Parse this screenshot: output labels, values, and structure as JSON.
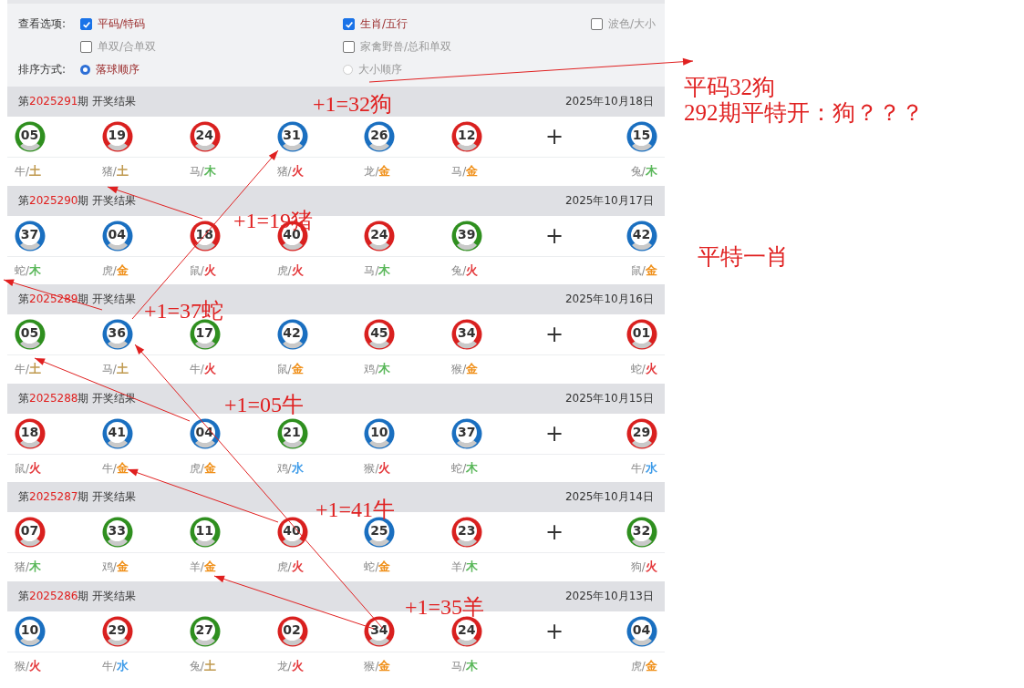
{
  "options": {
    "view_label": "查看选项:",
    "view_options": [
      {
        "label": "平码/特码",
        "checked": true
      },
      {
        "label": "生肖/五行",
        "checked": true
      },
      {
        "label": "波色/大小",
        "checked": false
      },
      {
        "label": "单双/合单双",
        "checked": false
      },
      {
        "label": "家禽野兽/总和单双",
        "checked": false
      }
    ],
    "sort_label": "排序方式:",
    "sort_options": [
      {
        "label": "落球顺序",
        "selected": true
      },
      {
        "label": "大小顺序",
        "selected": false
      }
    ]
  },
  "draws": [
    {
      "title_prefix": "第",
      "period": "2025291",
      "title_suffix": "期 开奖结果",
      "date": "2025年10月18日",
      "plus": "+",
      "balls": [
        {
          "number": "05",
          "color": "#2f8f1f",
          "zodiac": "牛/",
          "element": {
            "text": "土",
            "color": "#c09a50"
          }
        },
        {
          "number": "19",
          "color": "#d9201f",
          "zodiac": "猪/",
          "element": {
            "text": "土",
            "color": "#c09a50"
          }
        },
        {
          "number": "24",
          "color": "#d9201f",
          "zodiac": "马/",
          "element": {
            "text": "木",
            "color": "#5cb85c"
          }
        },
        {
          "number": "31",
          "color": "#1a6fc0",
          "zodiac": "猪/",
          "element": {
            "text": "火",
            "color": "#e4393c"
          }
        },
        {
          "number": "26",
          "color": "#1a6fc0",
          "zodiac": "龙/",
          "element": {
            "text": "金",
            "color": "#f0901a"
          }
        },
        {
          "number": "12",
          "color": "#d9201f",
          "zodiac": "马/",
          "element": {
            "text": "金",
            "color": "#f0901a"
          }
        }
      ],
      "special": {
        "number": "15",
        "color": "#1a6fc0",
        "zodiac": "兔/",
        "element": {
          "text": "木",
          "color": "#5cb85c"
        }
      }
    },
    {
      "title_prefix": "第",
      "period": "2025290",
      "title_suffix": "期 开奖结果",
      "date": "2025年10月17日",
      "plus": "+",
      "balls": [
        {
          "number": "37",
          "color": "#1a6fc0",
          "zodiac": "蛇/",
          "element": {
            "text": "木",
            "color": "#5cb85c"
          }
        },
        {
          "number": "04",
          "color": "#1a6fc0",
          "zodiac": "虎/",
          "element": {
            "text": "金",
            "color": "#f0901a"
          }
        },
        {
          "number": "18",
          "color": "#d9201f",
          "zodiac": "鼠/",
          "element": {
            "text": "火",
            "color": "#e4393c"
          }
        },
        {
          "number": "40",
          "color": "#d9201f",
          "zodiac": "虎/",
          "element": {
            "text": "火",
            "color": "#e4393c"
          }
        },
        {
          "number": "24",
          "color": "#d9201f",
          "zodiac": "马/",
          "element": {
            "text": "木",
            "color": "#5cb85c"
          }
        },
        {
          "number": "39",
          "color": "#2f8f1f",
          "zodiac": "兔/",
          "element": {
            "text": "火",
            "color": "#e4393c"
          }
        }
      ],
      "special": {
        "number": "42",
        "color": "#1a6fc0",
        "zodiac": "鼠/",
        "element": {
          "text": "金",
          "color": "#f0901a"
        }
      }
    },
    {
      "title_prefix": "第",
      "period": "2025289",
      "title_suffix": "期 开奖结果",
      "date": "2025年10月16日",
      "plus": "+",
      "balls": [
        {
          "number": "05",
          "color": "#2f8f1f",
          "zodiac": "牛/",
          "element": {
            "text": "土",
            "color": "#c09a50"
          }
        },
        {
          "number": "36",
          "color": "#1a6fc0",
          "zodiac": "马/",
          "element": {
            "text": "土",
            "color": "#c09a50"
          }
        },
        {
          "number": "17",
          "color": "#2f8f1f",
          "zodiac": "牛/",
          "element": {
            "text": "火",
            "color": "#e4393c"
          }
        },
        {
          "number": "42",
          "color": "#1a6fc0",
          "zodiac": "鼠/",
          "element": {
            "text": "金",
            "color": "#f0901a"
          }
        },
        {
          "number": "45",
          "color": "#d9201f",
          "zodiac": "鸡/",
          "element": {
            "text": "木",
            "color": "#5cb85c"
          }
        },
        {
          "number": "34",
          "color": "#d9201f",
          "zodiac": "猴/",
          "element": {
            "text": "金",
            "color": "#f0901a"
          }
        }
      ],
      "special": {
        "number": "01",
        "color": "#d9201f",
        "zodiac": "蛇/",
        "element": {
          "text": "火",
          "color": "#e4393c"
        }
      }
    },
    {
      "title_prefix": "第",
      "period": "2025288",
      "title_suffix": "期 开奖结果",
      "date": "2025年10月15日",
      "plus": "+",
      "balls": [
        {
          "number": "18",
          "color": "#d9201f",
          "zodiac": "鼠/",
          "element": {
            "text": "火",
            "color": "#e4393c"
          }
        },
        {
          "number": "41",
          "color": "#1a6fc0",
          "zodiac": "牛/",
          "element": {
            "text": "金",
            "color": "#f0901a"
          }
        },
        {
          "number": "04",
          "color": "#1a6fc0",
          "zodiac": "虎/",
          "element": {
            "text": "金",
            "color": "#f0901a"
          }
        },
        {
          "number": "21",
          "color": "#2f8f1f",
          "zodiac": "鸡/",
          "element": {
            "text": "水",
            "color": "#3d9be9"
          }
        },
        {
          "number": "10",
          "color": "#1a6fc0",
          "zodiac": "猴/",
          "element": {
            "text": "火",
            "color": "#e4393c"
          }
        },
        {
          "number": "37",
          "color": "#1a6fc0",
          "zodiac": "蛇/",
          "element": {
            "text": "木",
            "color": "#5cb85c"
          }
        }
      ],
      "special": {
        "number": "29",
        "color": "#d9201f",
        "zodiac": "牛/",
        "element": {
          "text": "水",
          "color": "#3d9be9"
        }
      }
    },
    {
      "title_prefix": "第",
      "period": "2025287",
      "title_suffix": "期 开奖结果",
      "date": "2025年10月14日",
      "plus": "+",
      "balls": [
        {
          "number": "07",
          "color": "#d9201f",
          "zodiac": "猪/",
          "element": {
            "text": "木",
            "color": "#5cb85c"
          }
        },
        {
          "number": "33",
          "color": "#2f8f1f",
          "zodiac": "鸡/",
          "element": {
            "text": "金",
            "color": "#f0901a"
          }
        },
        {
          "number": "11",
          "color": "#2f8f1f",
          "zodiac": "羊/",
          "element": {
            "text": "金",
            "color": "#f0901a"
          }
        },
        {
          "number": "40",
          "color": "#d9201f",
          "zodiac": "虎/",
          "element": {
            "text": "火",
            "color": "#e4393c"
          }
        },
        {
          "number": "25",
          "color": "#1a6fc0",
          "zodiac": "蛇/",
          "element": {
            "text": "金",
            "color": "#f0901a"
          }
        },
        {
          "number": "23",
          "color": "#d9201f",
          "zodiac": "羊/",
          "element": {
            "text": "木",
            "color": "#5cb85c"
          }
        }
      ],
      "special": {
        "number": "32",
        "color": "#2f8f1f",
        "zodiac": "狗/",
        "element": {
          "text": "火",
          "color": "#e4393c"
        }
      }
    },
    {
      "title_prefix": "第",
      "period": "2025286",
      "title_suffix": "期 开奖结果",
      "date": "2025年10月13日",
      "plus": "+",
      "balls": [
        {
          "number": "10",
          "color": "#1a6fc0",
          "zodiac": "猴/",
          "element": {
            "text": "火",
            "color": "#e4393c"
          }
        },
        {
          "number": "29",
          "color": "#d9201f",
          "zodiac": "牛/",
          "element": {
            "text": "水",
            "color": "#3d9be9"
          }
        },
        {
          "number": "27",
          "color": "#2f8f1f",
          "zodiac": "兔/",
          "element": {
            "text": "土",
            "color": "#c09a50"
          }
        },
        {
          "number": "02",
          "color": "#d9201f",
          "zodiac": "龙/",
          "element": {
            "text": "火",
            "color": "#e4393c"
          }
        },
        {
          "number": "34",
          "color": "#d9201f",
          "zodiac": "猴/",
          "element": {
            "text": "金",
            "color": "#f0901a"
          }
        },
        {
          "number": "24",
          "color": "#d9201f",
          "zodiac": "马/",
          "element": {
            "text": "木",
            "color": "#5cb85c"
          }
        }
      ],
      "special": {
        "number": "04",
        "color": "#1a6fc0",
        "zodiac": "虎/",
        "element": {
          "text": "金",
          "color": "#f0901a"
        }
      }
    }
  ],
  "annotations": [
    {
      "text": "+1=32狗"
    },
    {
      "text": "+1=19猪"
    },
    {
      "text": "+1=37蛇"
    },
    {
      "text": "+1=05牛"
    },
    {
      "text": "+1=41牛"
    },
    {
      "text": "+1=35羊"
    }
  ],
  "notes": [
    {
      "lines": [
        "平码32狗",
        "292期平特开：狗？？？"
      ]
    },
    {
      "lines": [
        "平特一肖"
      ]
    }
  ]
}
